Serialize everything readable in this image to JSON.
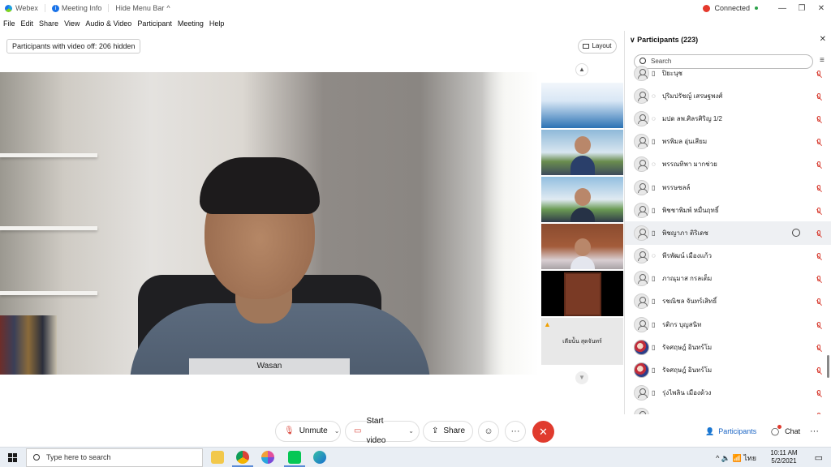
{
  "titlebar": {
    "app_name": "Webex",
    "meeting_info": "Meeting Info",
    "hide_menu": "Hide Menu Bar",
    "hide_menu_chevron": "^",
    "status": "Connected",
    "status_color": "#2ca24a",
    "minimize": "—",
    "maximize": "❐",
    "close": "✕"
  },
  "menu": [
    "File",
    "Edit",
    "Share",
    "View",
    "Audio & Video",
    "Participant",
    "Meeting",
    "Help"
  ],
  "notice": "Participants with video off: 206 hidden",
  "layout_label": "Layout",
  "main_video": {
    "speaker_name": "Wasan"
  },
  "filmstrip": {
    "warning_icon": "warning-icon",
    "last_label": "เตียน้ัน สุดจันทร์"
  },
  "panel": {
    "title": "Participants (223)",
    "chevron": "∨",
    "close": "✕",
    "search_placeholder": "Search",
    "participants": [
      {
        "name": "ปิยะนุช",
        "device": "▯",
        "avatar": "default"
      },
      {
        "name": "ปุริมปรัชญ์ เสรษฐพงศ์",
        "device": "◌",
        "avatar": "default"
      },
      {
        "name": "มปด ลพ.ศิลรศิริญ 1/2",
        "device": "◌",
        "avatar": "default"
      },
      {
        "name": "พรพิมล อุ่นเสียม",
        "device": "▯",
        "avatar": "default"
      },
      {
        "name": "พรรณทิพา มากช่วย",
        "device": "◌",
        "avatar": "default"
      },
      {
        "name": "พรรษชลล์",
        "device": "▯",
        "avatar": "default"
      },
      {
        "name": "พิชชาพิมพ์ หมื่นฤทธิ์",
        "device": "▯",
        "avatar": "default"
      },
      {
        "name": "พิชญาภา ติริเดช",
        "device": "▯",
        "avatar": "default",
        "highlight": true
      },
      {
        "name": "พีรพัฒน์ เมืองแก้ว",
        "device": "◌",
        "avatar": "default"
      },
      {
        "name": "ภาณุมาส กรลเต็ม",
        "device": "▯",
        "avatar": "default"
      },
      {
        "name": "รชณิชล จันทร์เสิทธิ์",
        "device": "▯",
        "avatar": "default"
      },
      {
        "name": "รติกร บุญสนิท",
        "device": "▯",
        "avatar": "default"
      },
      {
        "name": "รัจศฤษฎ์ อินทร์โม",
        "device": "▯",
        "avatar": "photo"
      },
      {
        "name": "รัจศฤษฎ์ อินทร์โม",
        "device": "▯",
        "avatar": "photo"
      },
      {
        "name": "รุ่งไพลิน เมืองด้วง",
        "device": "▯",
        "avatar": "default"
      },
      {
        "name": "",
        "device": "",
        "avatar": "default"
      }
    ]
  },
  "controls": {
    "unmute": "Unmute",
    "start_video": "Start video",
    "share": "Share",
    "chevron": "⌄",
    "reactions_icon": "☺",
    "more_icon": "···",
    "end_icon": "✕"
  },
  "right_controls": {
    "participants": "Participants",
    "chat": "Chat",
    "more": "···"
  },
  "taskbar": {
    "search_placeholder": "Type here to search",
    "tray_icons": "^  🔈  📶  ไทย",
    "time": "10:11 AM",
    "date": "5/2/2021",
    "notif_icon": "▭"
  }
}
